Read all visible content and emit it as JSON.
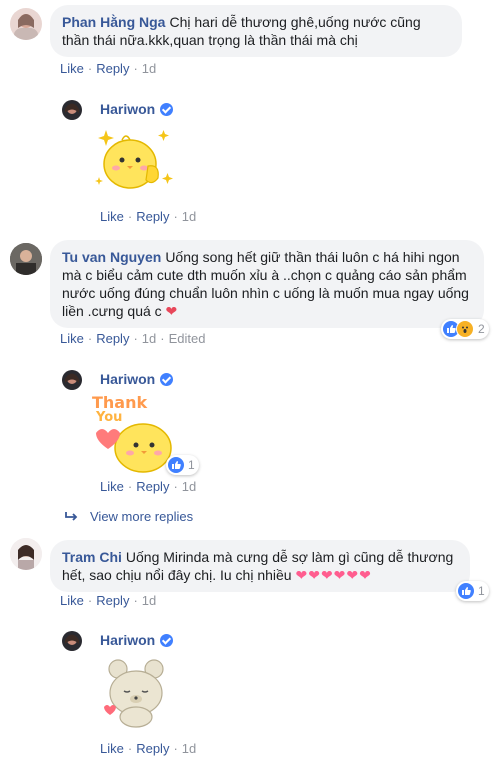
{
  "comments": [
    {
      "author": "Phan Hằng Nga",
      "text": "Chị hari dễ thương ghê,uống nước cũng thần thái nữa.kkk,quan trọng là thần thái mà chị",
      "like": "Like",
      "reply": "Reply",
      "time": "1d"
    },
    {
      "author": "Tu van Nguyen",
      "text": "Uống song hết giữ thần thái luôn c há hihi ngon mà c biểu cảm cute dth muốn xỉu à ..chọn c quảng cáo sản phẩm nước uống đúng chuẩn luôn nhìn c uống là muốn mua ngay uống liền .cưng quá c",
      "like": "Like",
      "reply": "Reply",
      "time": "1d",
      "edited": "Edited",
      "reaction_count": "2"
    },
    {
      "author": "Tram Chi",
      "text": "Uống Mirinda mà cưng dễ sợ làm gì cũng dễ thương hết, sao chịu nổi đây chị. Iu chị nhiều",
      "like": "Like",
      "reply": "Reply",
      "time": "1d",
      "reaction_count": "1"
    }
  ],
  "replies": [
    {
      "author": "Hariwon",
      "like": "Like",
      "reply": "Reply",
      "time": "1d"
    },
    {
      "author": "Hariwon",
      "like": "Like",
      "reply": "Reply",
      "time": "1d",
      "reaction_count": "1",
      "sticker_text": [
        "Thank",
        "You"
      ]
    },
    {
      "author": "Hariwon",
      "like": "Like",
      "reply": "Reply",
      "time": "1d"
    }
  ],
  "view_more": "View more replies",
  "colors": {
    "link": "#385898",
    "bubble": "#f2f3f5",
    "meta": "#90949c",
    "like_blue": "#4080ff"
  }
}
